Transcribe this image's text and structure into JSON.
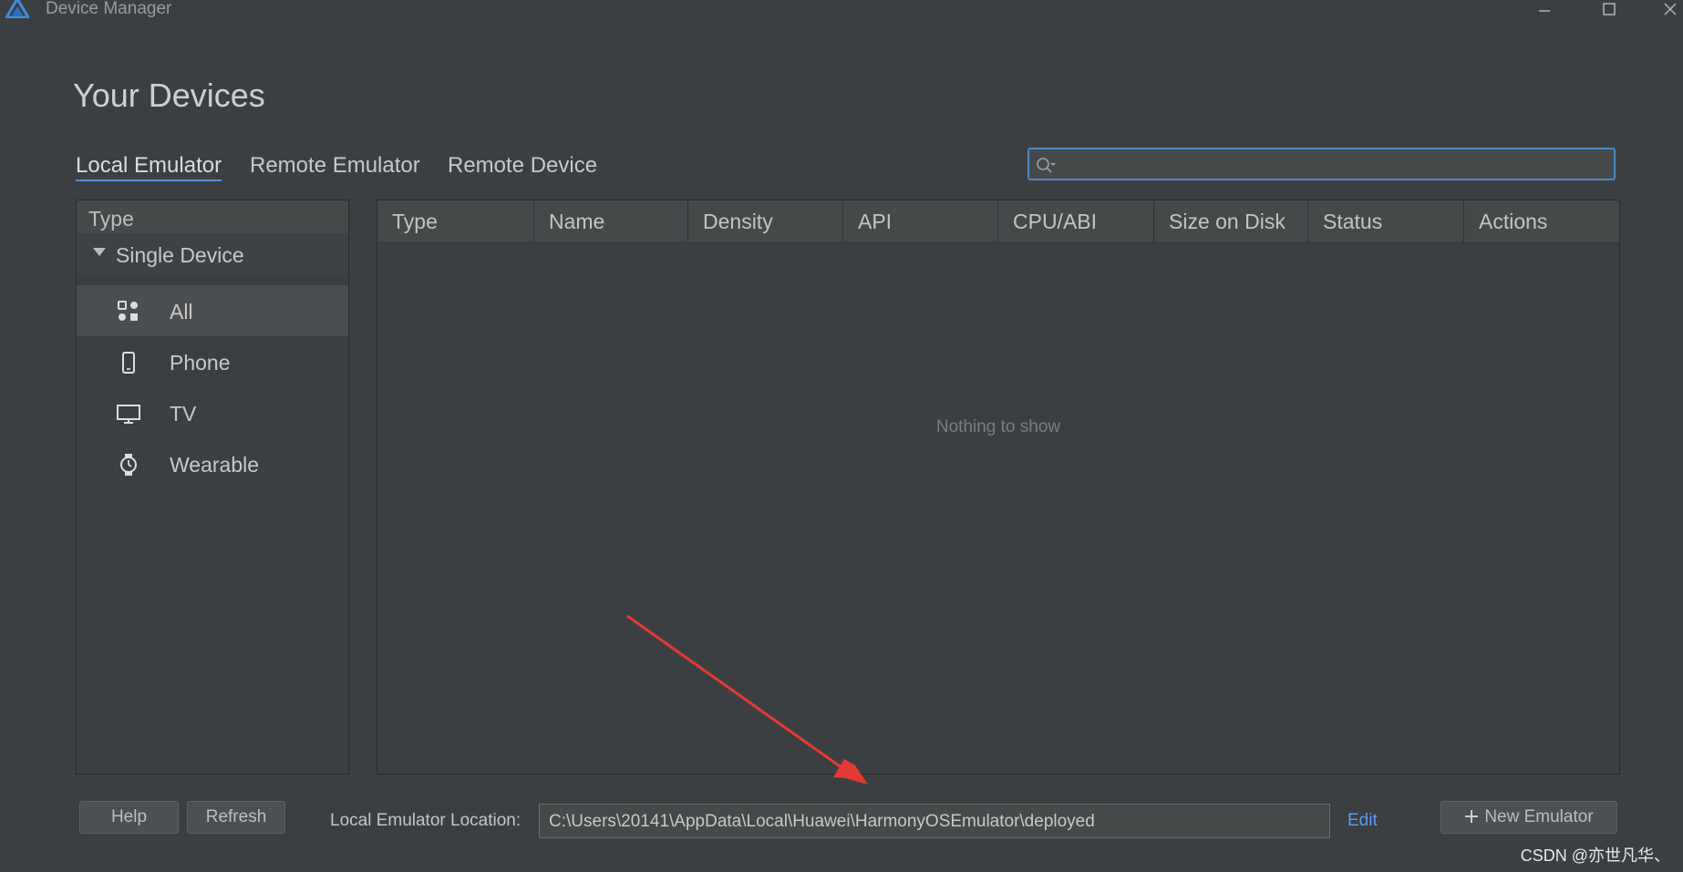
{
  "window": {
    "title": "Device Manager",
    "controls": [
      "minimize",
      "maximize",
      "close"
    ]
  },
  "page": {
    "title": "Your Devices"
  },
  "tabs": [
    {
      "label": "Local Emulator",
      "active": true
    },
    {
      "label": "Remote Emulator",
      "active": false
    },
    {
      "label": "Remote Device",
      "active": false
    }
  ],
  "search": {
    "value": "",
    "placeholder": "",
    "icon": "search-icon"
  },
  "sidebar": {
    "header": "Type",
    "group": "Single Device",
    "items": [
      {
        "label": "All",
        "icon": "all-devices-icon",
        "selected": true
      },
      {
        "label": "Phone",
        "icon": "phone-icon",
        "selected": false
      },
      {
        "label": "TV",
        "icon": "tv-icon",
        "selected": false
      },
      {
        "label": "Wearable",
        "icon": "watch-icon",
        "selected": false
      }
    ]
  },
  "table": {
    "columns": [
      "Type",
      "Name",
      "Density",
      "API",
      "CPU/ABI",
      "Size on Disk",
      "Status",
      "Actions"
    ],
    "rows": [],
    "empty_message": "Nothing to show"
  },
  "footer": {
    "help_label": "Help",
    "refresh_label": "Refresh",
    "location_label": "Local Emulator Location:",
    "location_value": "C:\\Users\\20141\\AppData\\Local\\Huawei\\HarmonyOSEmulator\\deployed",
    "edit_label": "Edit",
    "new_emulator_label": "New Emulator"
  },
  "watermark": "CSDN @亦世凡华、",
  "colors": {
    "background": "#3c3f41",
    "accent": "#589df6",
    "annotation_arrow": "#e53935"
  }
}
